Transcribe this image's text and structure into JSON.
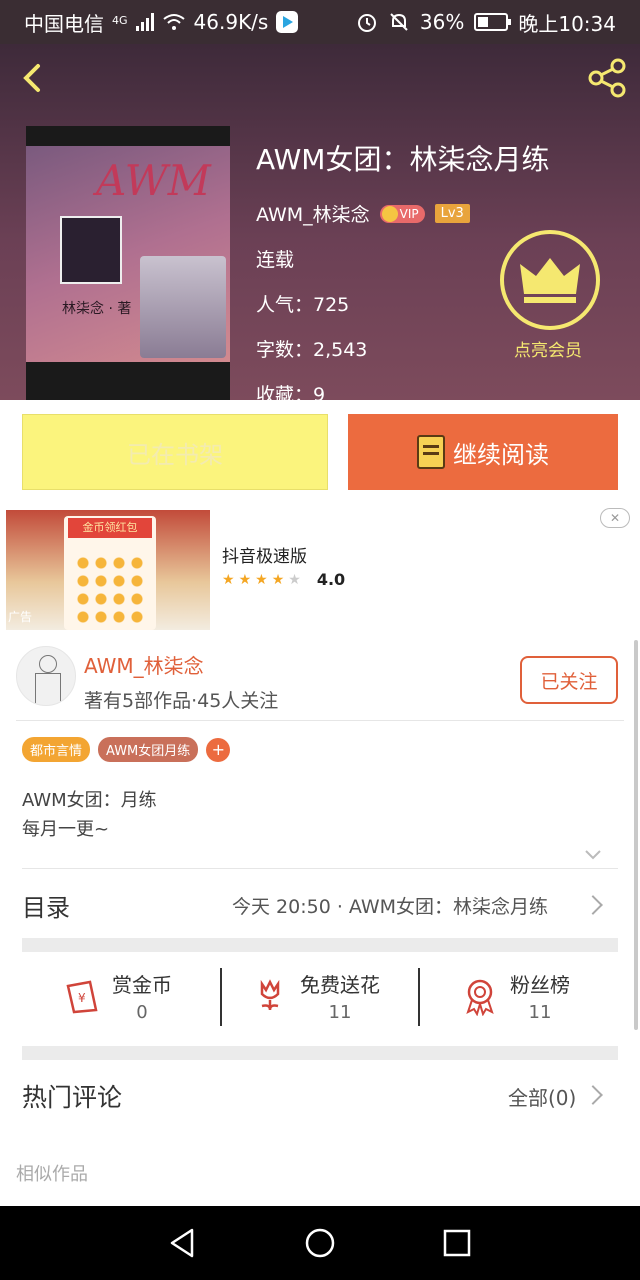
{
  "status_bar": {
    "carrier": "中国电信",
    "network": "4G",
    "speed": "46.9K/s",
    "battery": "36%",
    "time": "晚上10:34",
    "icons": [
      "signal-icon",
      "wifi-icon",
      "video-app-icon",
      "alarm-icon",
      "mute-icon",
      "battery-icon"
    ]
  },
  "header": {
    "back_icon": "chevron-left-icon",
    "share_icon": "share-icon",
    "cover": {
      "title_text": "AWM",
      "sub_text": "林柒念 · 著"
    },
    "book_title": "AWM女团：林柒念月练",
    "author": "AWM_林柒念",
    "vip_badge": "VIP",
    "level_badge": "Lv3",
    "status": "连载",
    "popularity": "人气：725",
    "word_count": "字数：2,543",
    "favorites": "收藏：9",
    "vip_label": "点亮会员"
  },
  "actions": {
    "shelf_label": "已在书架",
    "read_label": "继续阅读"
  },
  "ad": {
    "banner_text": "金币领红包",
    "tag": "广告",
    "app_name": "抖音极速版",
    "rating": 4.0,
    "rating_text": "4.0",
    "close_icon": "close-icon"
  },
  "author_section": {
    "name": "AWM_林柒念",
    "stats": "著有5部作品·45人关注",
    "follow_label": "已关注"
  },
  "tags": [
    "都市言情",
    "AWM女团月练"
  ],
  "tag_add": "+",
  "description": {
    "line1": "AWM女团：月练",
    "line2": "每月一更~"
  },
  "catalog": {
    "label": "目录",
    "latest": "今天 20:50 · AWM女团：林柒念月练"
  },
  "stats": [
    {
      "label": "赏金币",
      "value": "0",
      "icon": "red-envelope-icon"
    },
    {
      "label": "免费送花",
      "value": "11",
      "icon": "flower-icon"
    },
    {
      "label": "粉丝榜",
      "value": "11",
      "icon": "medal-icon"
    }
  ],
  "comments": {
    "title": "热门评论",
    "all_label": "全部(0)"
  },
  "similar_label": "相似作品",
  "colors": {
    "accent": "#ec6b3f",
    "shelf_bg": "#fbf47d",
    "vip_yellow": "#f5e870",
    "author_orange": "#e0603a"
  }
}
